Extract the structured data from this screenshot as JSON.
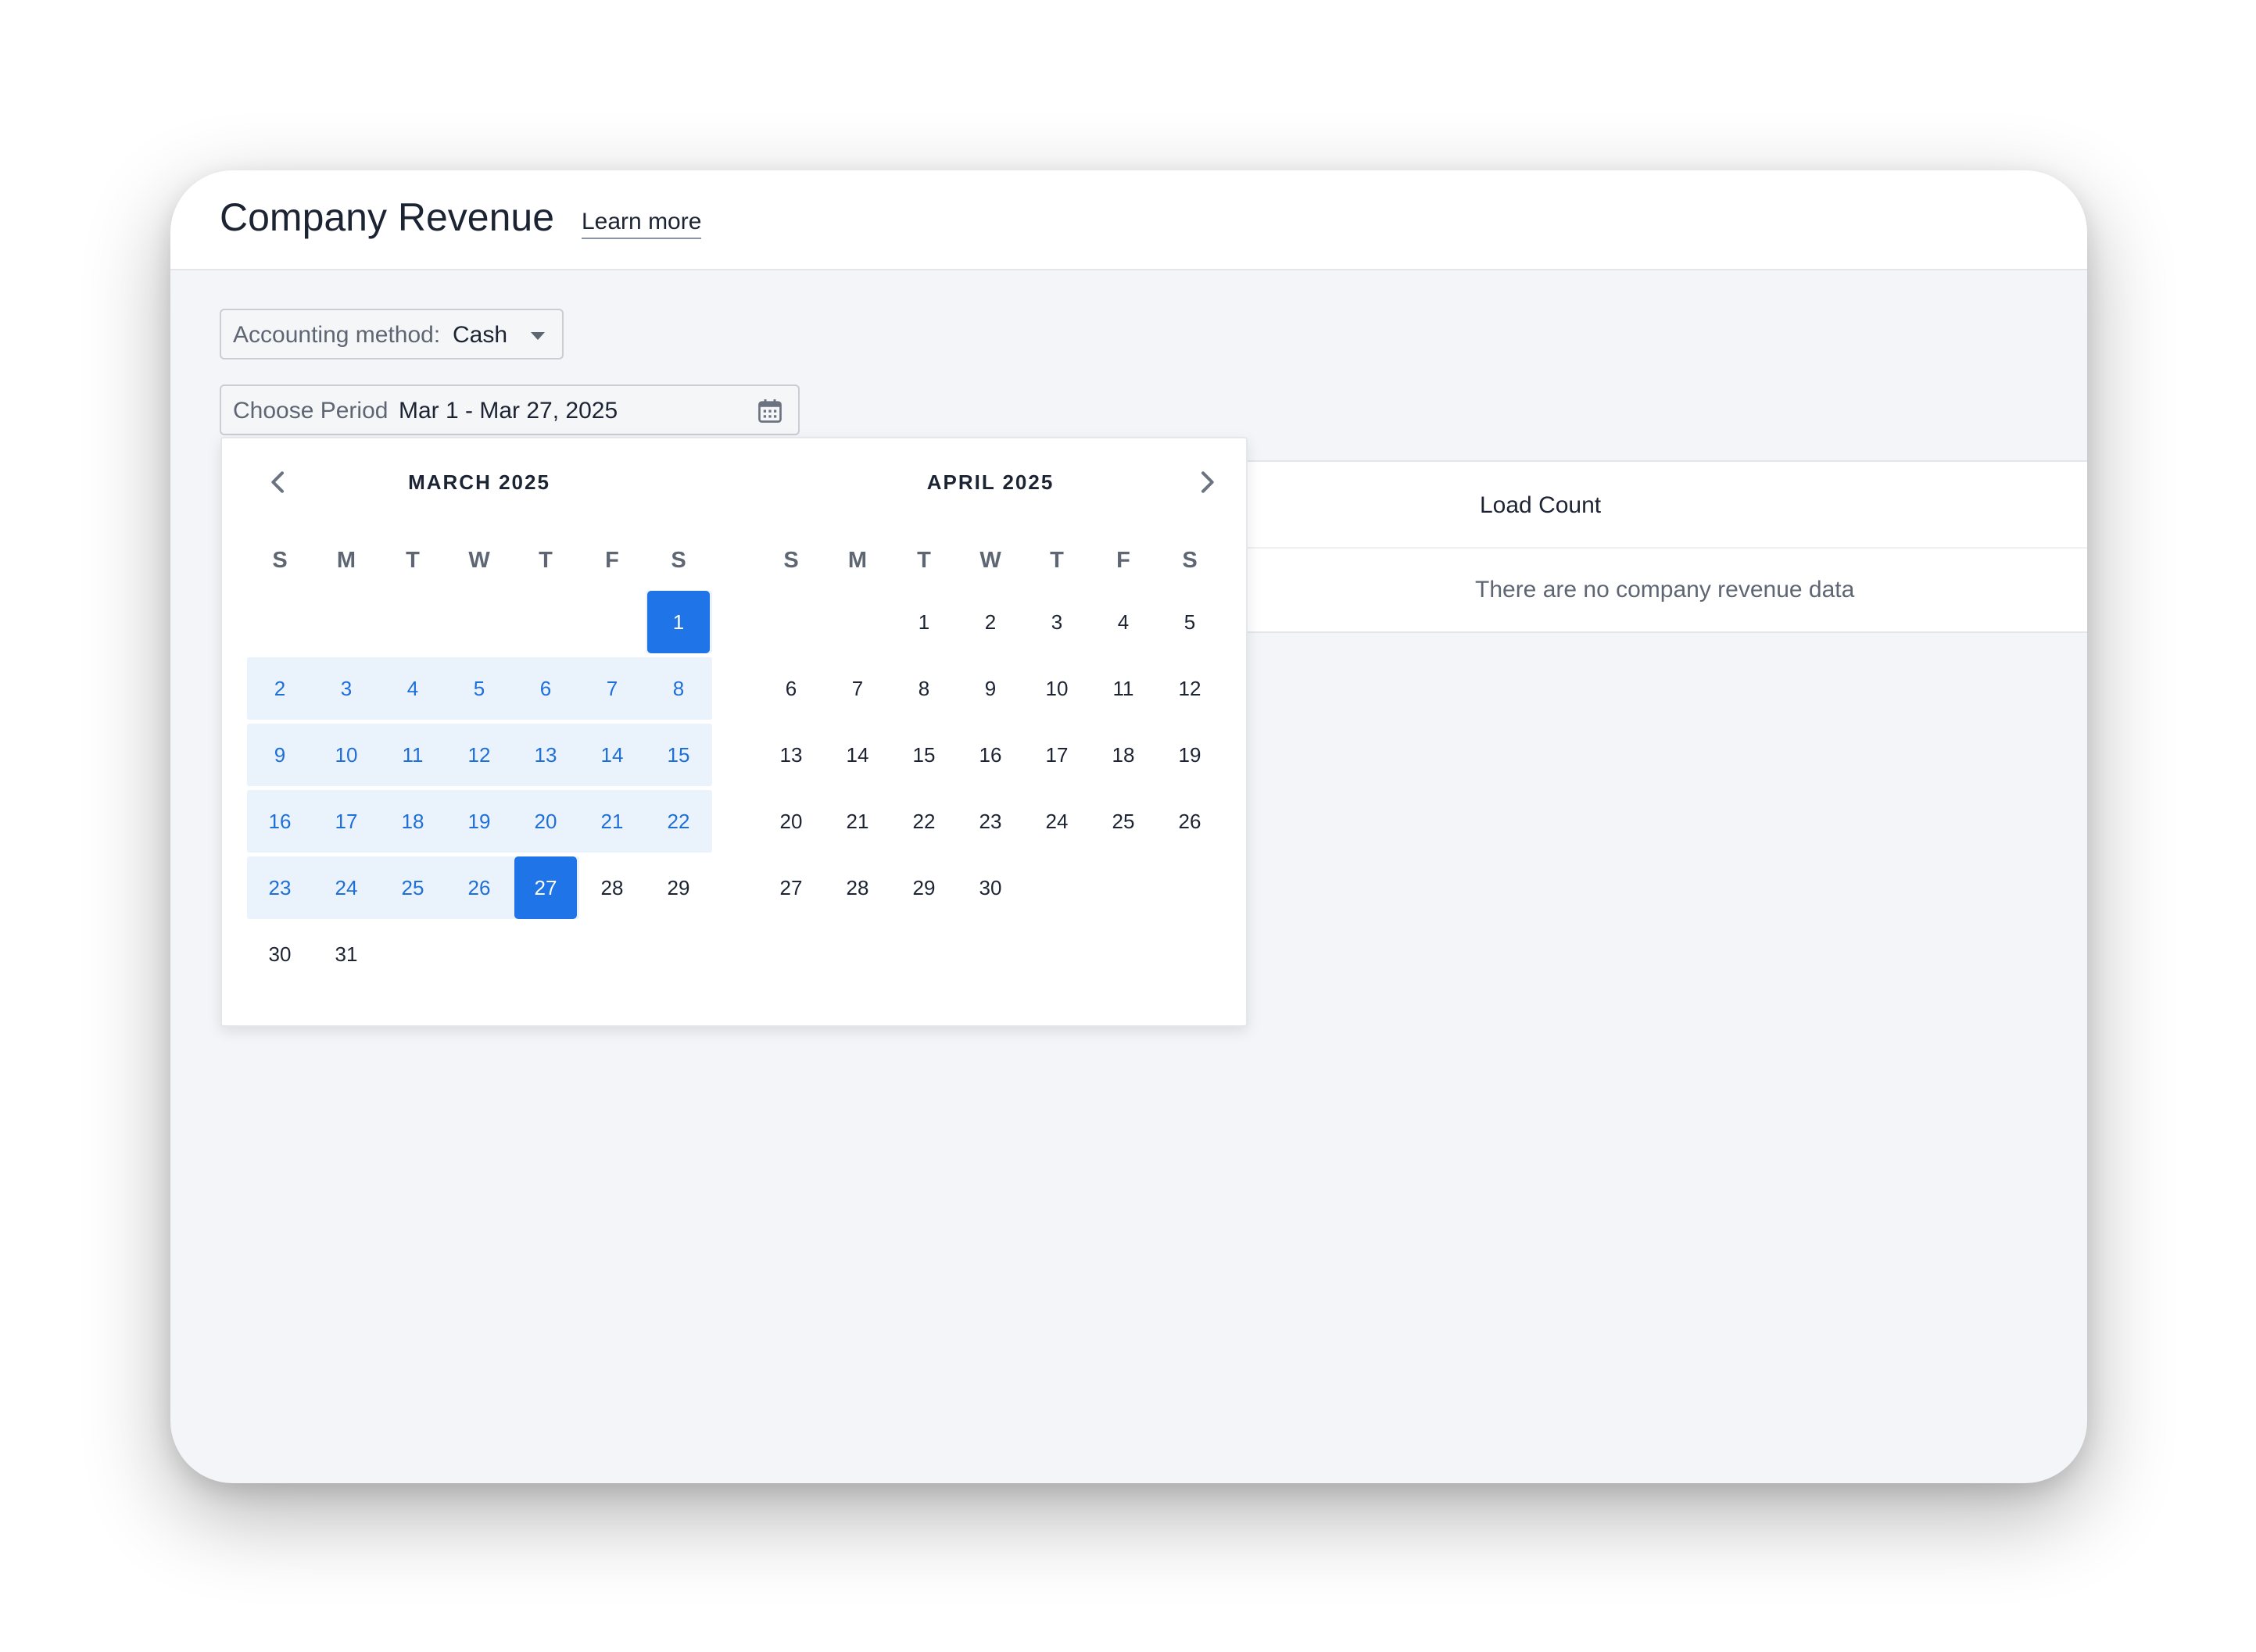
{
  "header": {
    "title": "Company Revenue",
    "learn_more": "Learn more"
  },
  "filters": {
    "accounting_label": "Accounting method:",
    "accounting_value": "Cash",
    "period_label": "Choose Period",
    "period_value": "Mar 1 - Mar 27, 2025"
  },
  "table": {
    "column_header": "Load Count",
    "empty_message": "There are no company revenue data"
  },
  "datepicker": {
    "weekdays": [
      "S",
      "M",
      "T",
      "W",
      "T",
      "F",
      "S"
    ],
    "left": {
      "title": "MARCH 2025",
      "first_weekday": 6,
      "days_in_month": 31
    },
    "right": {
      "title": "APRIL 2025",
      "first_weekday": 2,
      "days_in_month": 30
    },
    "range_start": 1,
    "range_end": 27,
    "colors": {
      "accent": "#1f74e8",
      "range_bg": "#eaf2fc",
      "range_text": "#1f6fd8"
    }
  }
}
